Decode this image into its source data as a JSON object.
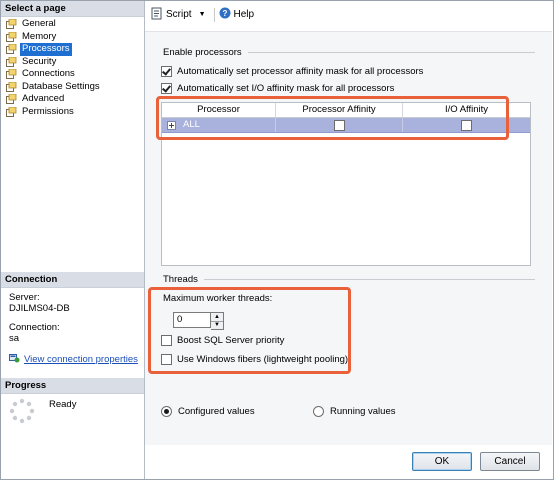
{
  "left_pane": {
    "select_page_header": "Select a page",
    "pages": [
      {
        "label": "General",
        "selected": false
      },
      {
        "label": "Memory",
        "selected": false
      },
      {
        "label": "Processors",
        "selected": true
      },
      {
        "label": "Security",
        "selected": false
      },
      {
        "label": "Connections",
        "selected": false
      },
      {
        "label": "Database Settings",
        "selected": false
      },
      {
        "label": "Advanced",
        "selected": false
      },
      {
        "label": "Permissions",
        "selected": false
      }
    ],
    "connection_header": "Connection",
    "server_label": "Server:",
    "server_value": "DJILMS04-DB",
    "connection_label": "Connection:",
    "connection_value": "sa",
    "view_connection_link": "View connection properties",
    "progress_header": "Progress",
    "progress_status": "Ready"
  },
  "toolbar": {
    "script_label": "Script",
    "help_label": "Help"
  },
  "processors": {
    "section_title": "Enable processors",
    "auto_processor_affinity_label": "Automatically set processor affinity mask for all processors",
    "auto_processor_affinity_checked": true,
    "auto_io_affinity_label": "Automatically set I/O affinity mask for all processors",
    "auto_io_affinity_checked": true,
    "grid": {
      "columns": [
        "Processor",
        "Processor Affinity",
        "I/O Affinity"
      ],
      "rows": [
        {
          "processor": "ALL",
          "processor_affinity": false,
          "io_affinity": false
        }
      ]
    }
  },
  "threads": {
    "section_title": "Threads",
    "max_worker_label": "Maximum worker threads:",
    "max_worker_value": "0",
    "boost_priority_label": "Boost SQL Server priority",
    "boost_priority_checked": false,
    "windows_fibers_label": "Use Windows fibers (lightweight pooling)",
    "windows_fibers_checked": false
  },
  "values_mode": {
    "configured_label": "Configured values",
    "running_label": "Running values",
    "selected": "configured"
  },
  "footer": {
    "ok_label": "OK",
    "cancel_label": "Cancel"
  },
  "colors": {
    "highlight": "#e8613b",
    "selection": "#1e6fd1",
    "grid_row": "#a8b2dd"
  }
}
